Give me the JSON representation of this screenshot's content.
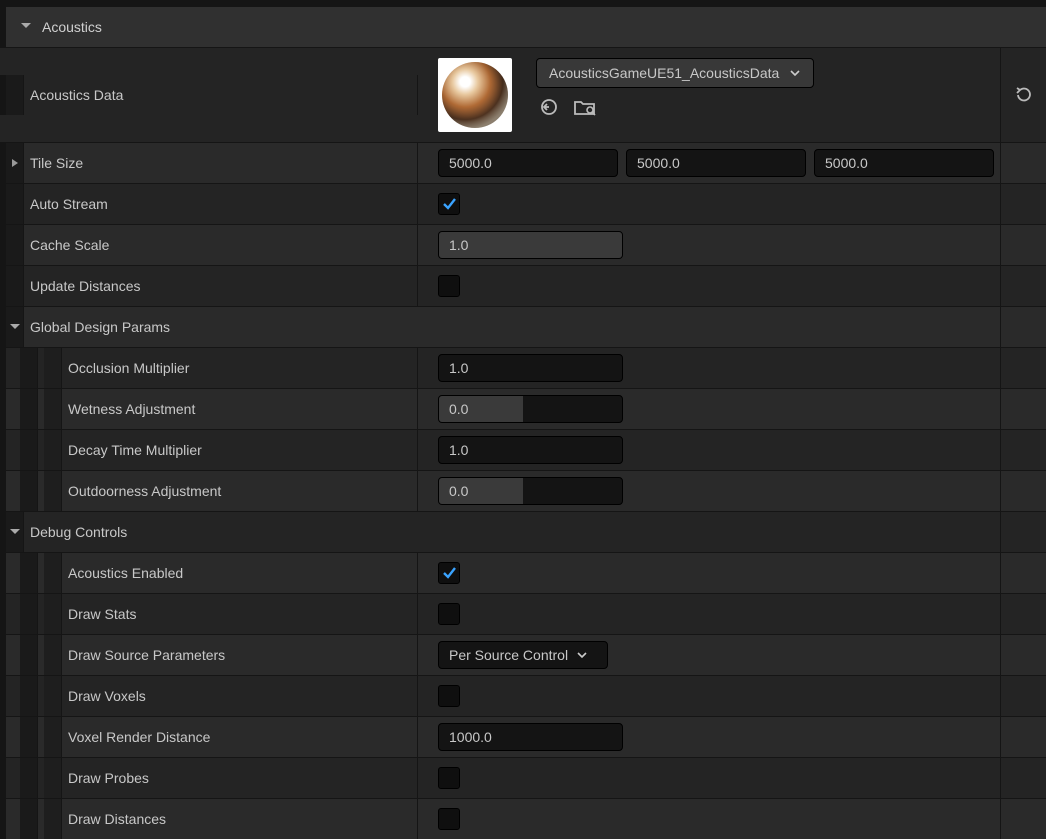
{
  "sections": {
    "acoustics": "Acoustics",
    "globalDesign": "Global Design Params",
    "debug": "Debug Controls"
  },
  "acousticsData": {
    "label": "Acoustics Data",
    "asset": "AcousticsGameUE51_AcousticsData"
  },
  "tileSize": {
    "label": "Tile Size",
    "x": "5000.0",
    "y": "5000.0",
    "z": "5000.0"
  },
  "autoStream": {
    "label": "Auto Stream",
    "checked": true
  },
  "cacheScale": {
    "label": "Cache Scale",
    "value": "1.0",
    "fill": 100
  },
  "updateDistances": {
    "label": "Update Distances",
    "checked": false
  },
  "occlusion": {
    "label": "Occlusion Multiplier",
    "value": "1.0"
  },
  "wetness": {
    "label": "Wetness Adjustment",
    "value": "0.0",
    "fill": 46
  },
  "decay": {
    "label": "Decay Time Multiplier",
    "value": "1.0"
  },
  "outdoor": {
    "label": "Outdoorness Adjustment",
    "value": "0.0",
    "fill": 46
  },
  "acousticsEnabled": {
    "label": "Acoustics Enabled",
    "checked": true
  },
  "drawStats": {
    "label": "Draw Stats",
    "checked": false
  },
  "drawSourceParams": {
    "label": "Draw Source Parameters",
    "value": "Per Source Control"
  },
  "drawVoxels": {
    "label": "Draw Voxels",
    "checked": false
  },
  "voxelRenderDist": {
    "label": "Voxel Render Distance",
    "value": "1000.0"
  },
  "drawProbes": {
    "label": "Draw Probes",
    "checked": false
  },
  "drawDistances": {
    "label": "Draw Distances",
    "checked": false
  }
}
